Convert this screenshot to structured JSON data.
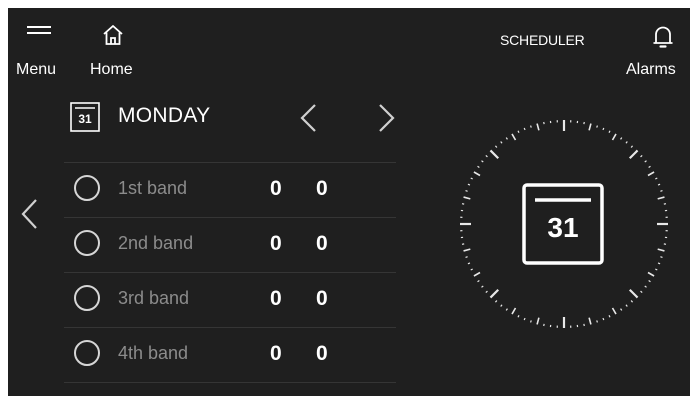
{
  "header": {
    "menu_label": "Menu",
    "home_label": "Home",
    "title": "SCHEDULER",
    "alarms_label": "Alarms"
  },
  "icons": {
    "menu": "hamburger-icon",
    "home": "home-icon",
    "alarms": "bell-icon",
    "calendar": "calendar-icon",
    "prev": "chevron-left-icon",
    "next": "chevron-right-icon"
  },
  "day": {
    "calendar_number": "31",
    "name": "MONDAY"
  },
  "bands": [
    {
      "label": "1st band",
      "value_a": "0",
      "value_b": "0"
    },
    {
      "label": "2nd band",
      "value_a": "0",
      "value_b": "0"
    },
    {
      "label": "3rd band",
      "value_a": "0",
      "value_b": "0"
    },
    {
      "label": "4th band",
      "value_a": "0",
      "value_b": "0"
    }
  ],
  "dial": {
    "calendar_number": "31"
  },
  "colors": {
    "background": "#1f1f1f",
    "foreground": "#ffffff",
    "muted_text": "#8c8c8c",
    "divider": "#353535"
  }
}
